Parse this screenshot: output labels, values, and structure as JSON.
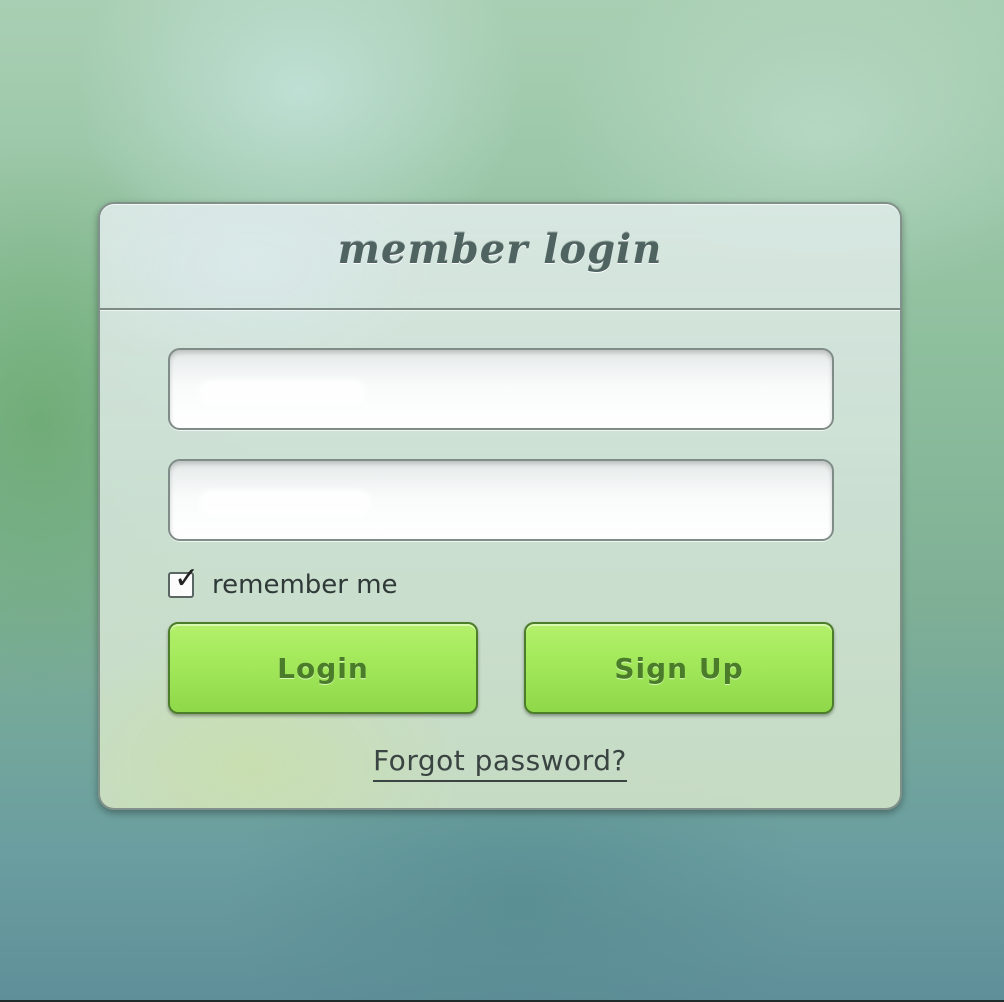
{
  "login_panel": {
    "title": "member login",
    "username_field": {
      "value": "",
      "placeholder": ""
    },
    "password_field": {
      "value": "",
      "placeholder": ""
    },
    "remember_me": {
      "label": "remember me",
      "checked": true,
      "check_glyph": "✓"
    },
    "login_button": {
      "label": "Login"
    },
    "signup_button": {
      "label": "Sign Up"
    },
    "forgot_password": {
      "label": "Forgot password?"
    }
  },
  "colors": {
    "button_green": "#a2e85a",
    "button_text": "#4a7c2a",
    "title_text": "#4f6360"
  }
}
